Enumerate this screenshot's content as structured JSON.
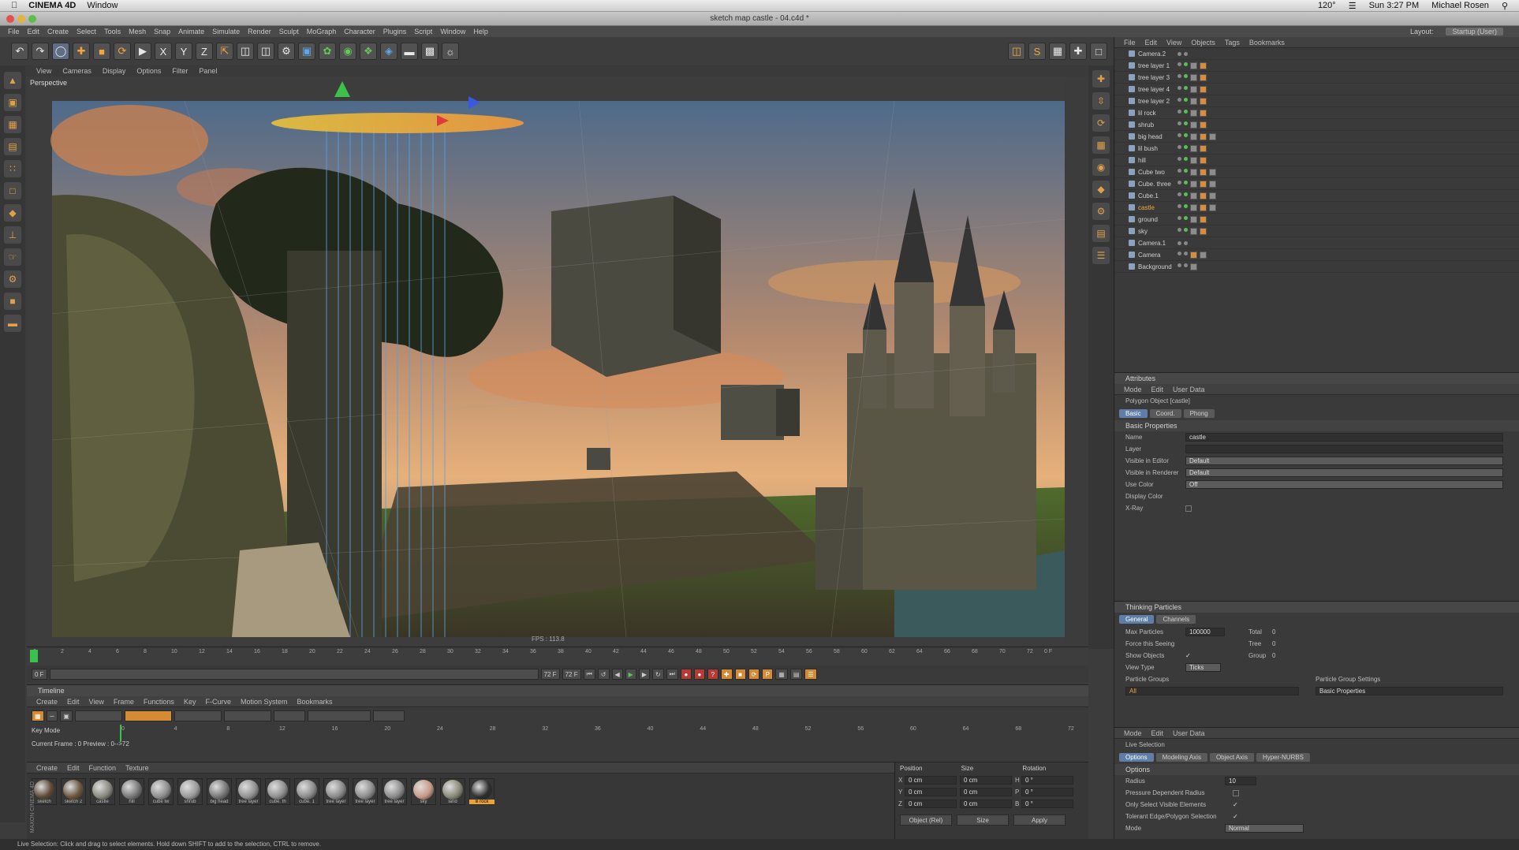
{
  "mac_menubar": {
    "app_name": "CINEMA 4D",
    "menu": "Window",
    "temperature": "120°",
    "clock": "Sun 3:27 PM",
    "user": "Michael Rosen"
  },
  "window": {
    "title": "sketch map castle - 04.c4d *"
  },
  "menubar": {
    "items": [
      "File",
      "Edit",
      "Create",
      "Select",
      "Tools",
      "Mesh",
      "Snap",
      "Animate",
      "Simulate",
      "Render",
      "Sculpt",
      "MoGraph",
      "Character",
      "Plugins",
      "Script",
      "Window",
      "Help"
    ],
    "layout_label": "Layout:",
    "layout_value": "Startup (User)"
  },
  "viewport": {
    "menu": [
      "View",
      "Cameras",
      "Display",
      "Options",
      "Filter",
      "Panel"
    ],
    "label": "Perspective",
    "fps": "FPS : 113.8"
  },
  "object_manager": {
    "menu": [
      "File",
      "Edit",
      "View",
      "Objects",
      "Tags",
      "Bookmarks"
    ],
    "objects": [
      {
        "name": "Camera.2"
      },
      {
        "name": "tree layer 1"
      },
      {
        "name": "tree layer 3"
      },
      {
        "name": "tree layer 4"
      },
      {
        "name": "tree layer 2"
      },
      {
        "name": "lil rock"
      },
      {
        "name": "shrub"
      },
      {
        "name": "big head"
      },
      {
        "name": "lil bush"
      },
      {
        "name": "hill"
      },
      {
        "name": "Cube two"
      },
      {
        "name": "Cube. three"
      },
      {
        "name": "Cube.1"
      },
      {
        "name": "castle"
      },
      {
        "name": "ground"
      },
      {
        "name": "sky"
      },
      {
        "name": "Camera.1"
      },
      {
        "name": "Camera"
      },
      {
        "name": "Background"
      }
    ]
  },
  "attributes": {
    "header": "Attributes",
    "menu": [
      "Mode",
      "Edit",
      "User Data"
    ],
    "object_label": "Polygon Object [castle]",
    "tabs": [
      "Basic",
      "Coord.",
      "Phong"
    ],
    "section": "Basic Properties",
    "props": [
      {
        "label": "Name",
        "value": "castle"
      },
      {
        "label": "Layer",
        "value": ""
      },
      {
        "label": "Visible in Editor",
        "value": "Default"
      },
      {
        "label": "Visible in Renderer",
        "value": "Default"
      },
      {
        "label": "Use Color",
        "value": "Off"
      },
      {
        "label": "Display Color",
        "value": ""
      },
      {
        "label": "X-Ray",
        "value": ""
      }
    ]
  },
  "thinking_particles": {
    "header": "Thinking Particles",
    "tabs": [
      "General",
      "Channels"
    ],
    "max_particles_label": "Max Particles",
    "max_particles_value": "100000",
    "total_label": "Total",
    "total_value": "0",
    "force_label": "Force this Seeing",
    "tree_label": "Tree",
    "tree_value": "0",
    "show_objects_label": "Show Objects",
    "group_label": "Group",
    "group_value": "0",
    "view_type_label": "View Type",
    "view_type_value": "Ticks",
    "groups_label": "Particle Groups",
    "groups_settings_label": "Particle Group Settings",
    "all_label": "All",
    "basic_props": "Basic Properties"
  },
  "live_selection": {
    "menu": [
      "Mode",
      "Edit",
      "User Data"
    ],
    "title": "Live Selection",
    "tabs": [
      "Options",
      "Modeling Axis",
      "Object Axis",
      "Hyper-NURBS"
    ],
    "section": "Options",
    "radius_label": "Radius",
    "radius_value": "10",
    "opt1": "Pressure Dependent Radius",
    "opt2": "Only Select Visible Elements",
    "opt3": "Tolerant Edge/Polygon Selection",
    "mode_label": "Mode",
    "mode_value": "Normal"
  },
  "ruler_ticks": [
    "0",
    "2",
    "4",
    "6",
    "8",
    "10",
    "12",
    "14",
    "16",
    "18",
    "20",
    "22",
    "24",
    "26",
    "28",
    "30",
    "32",
    "34",
    "36",
    "38",
    "40",
    "42",
    "44",
    "46",
    "48",
    "50",
    "52",
    "54",
    "56",
    "58",
    "60",
    "62",
    "64",
    "66",
    "68",
    "70",
    "72"
  ],
  "ruler_end": "0 F",
  "playbar": {
    "start": "0 F",
    "mid": "72 F",
    "end": "72 F"
  },
  "timeline": {
    "title": "Timeline",
    "menu": [
      "Create",
      "Edit",
      "View",
      "Frame",
      "Functions",
      "Key",
      "F-Curve",
      "Motion System",
      "Bookmarks"
    ],
    "key_mode": "Key Mode",
    "current_frame": "Current Frame : 0   Preview : 0-->72",
    "ticks": [
      "0",
      "4",
      "8",
      "12",
      "16",
      "20",
      "24",
      "28",
      "32",
      "36",
      "40",
      "44",
      "48",
      "52",
      "56",
      "60",
      "64",
      "68",
      "72"
    ]
  },
  "materials": {
    "menu": [
      "Create",
      "Edit",
      "Function",
      "Texture"
    ],
    "items": [
      {
        "name": "sketch",
        "color": "#5e4a35"
      },
      {
        "name": "sketch 2",
        "color": "#6b563e"
      },
      {
        "name": "castle",
        "color": "#8a8a80"
      },
      {
        "name": "hill",
        "color": "#777"
      },
      {
        "name": "cube tw",
        "color": "#8d8d8d"
      },
      {
        "name": "shrub",
        "color": "#999"
      },
      {
        "name": "big head",
        "color": "#777"
      },
      {
        "name": "tree layer",
        "color": "#929292"
      },
      {
        "name": "cube. th",
        "color": "#8f8f8f"
      },
      {
        "name": "cube. 1",
        "color": "#8b8b8b"
      },
      {
        "name": "tree layer",
        "color": "#8a8a8a"
      },
      {
        "name": "tree layer",
        "color": "#8c8c8c"
      },
      {
        "name": "tree layer",
        "color": "#8b8b8b"
      },
      {
        "name": "sky",
        "color": "#c99a86"
      },
      {
        "name": "land",
        "color": "#8a8a78"
      },
      {
        "name": "lil rock",
        "color": "#2e2e2e"
      }
    ]
  },
  "coordinates": {
    "col1": "Position",
    "col2": "Size",
    "col3": "Rotation",
    "rows": [
      {
        "axis": "X",
        "pos": "0 cm",
        "size": "0 cm",
        "rot_axis": "H",
        "rot": "0 °"
      },
      {
        "axis": "Y",
        "pos": "0 cm",
        "size": "0 cm",
        "rot_axis": "P",
        "rot": "0 °"
      },
      {
        "axis": "Z",
        "pos": "0 cm",
        "size": "0 cm",
        "rot_axis": "B",
        "rot": "0 °"
      }
    ],
    "mode": "Object (Rel)",
    "size_mode": "Size",
    "apply": "Apply"
  },
  "status_text": "Live Selection: Click and drag to select elements. Hold down SHIFT to add to the selection, CTRL to remove.",
  "brand": "MAXON CINEMA 4D",
  "colors": {
    "accent_blue": "#5f7ea7",
    "selection_orange": "#e8a33d",
    "record_red": "#b83a34"
  }
}
